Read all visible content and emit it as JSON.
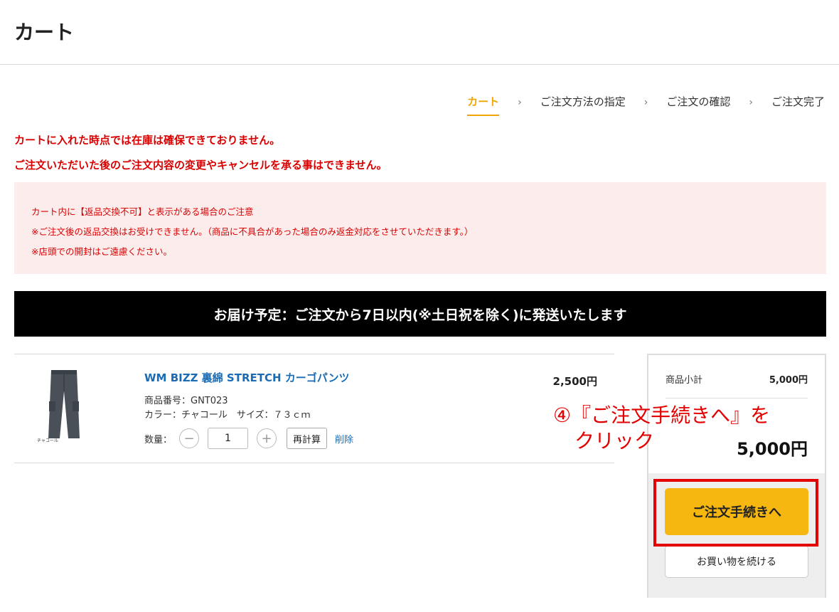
{
  "page": {
    "title": "カート"
  },
  "steps": [
    {
      "label": "カート",
      "active": true
    },
    {
      "label": "ご注文方法の指定",
      "active": false
    },
    {
      "label": "ご注文の確認",
      "active": false
    },
    {
      "label": "ご注文完了",
      "active": false
    }
  ],
  "step_separator": "›",
  "warnings": {
    "line1": "カートに入れた時点では在庫は確保できておりません。",
    "line2": "ご注文いただいた後のご注文内容の変更やキャンセルを承る事はできません。"
  },
  "notice": {
    "title": "カート内に【返品交換不可】と表示がある場合のご注意",
    "line1": "※ご注文後の返品交換はお受けできません。（商品に不具合があった場合のみ返金対応をさせていただきます。）",
    "line2": "※店頭での開封はご遠慮ください。"
  },
  "delivery_banner": "お届け予定：ご注文から7日以内(※土日祝を除く)に発送いたします",
  "cart_item": {
    "name": "WM BIZZ 裏綿 STRETCH カーゴパンツ",
    "code": "商品番号：GNT023",
    "spec": "カラー：チャコール　サイズ：７３ｃｍ",
    "image_caption": "チャコール",
    "qty_label": "数量：",
    "qty_value": "1",
    "minus_symbol": "−",
    "plus_symbol": "+",
    "recalc_label": "再計算",
    "delete_label": "削除",
    "price": "2,500円"
  },
  "summary": {
    "subtotal_label": "商品小計",
    "subtotal_value": "5,000円",
    "total_value": "5,000円",
    "checkout_label": "ご注文手続きへ",
    "continue_label": "お買い物を続ける"
  },
  "annotation": {
    "line1": "④『ご注文手続きへ』を",
    "line2": "クリック"
  },
  "colors": {
    "accent": "#f0a500",
    "checkout": "#f5b710",
    "warning": "#d80000",
    "link": "#1a6bb5",
    "highlight": "#e40000"
  }
}
